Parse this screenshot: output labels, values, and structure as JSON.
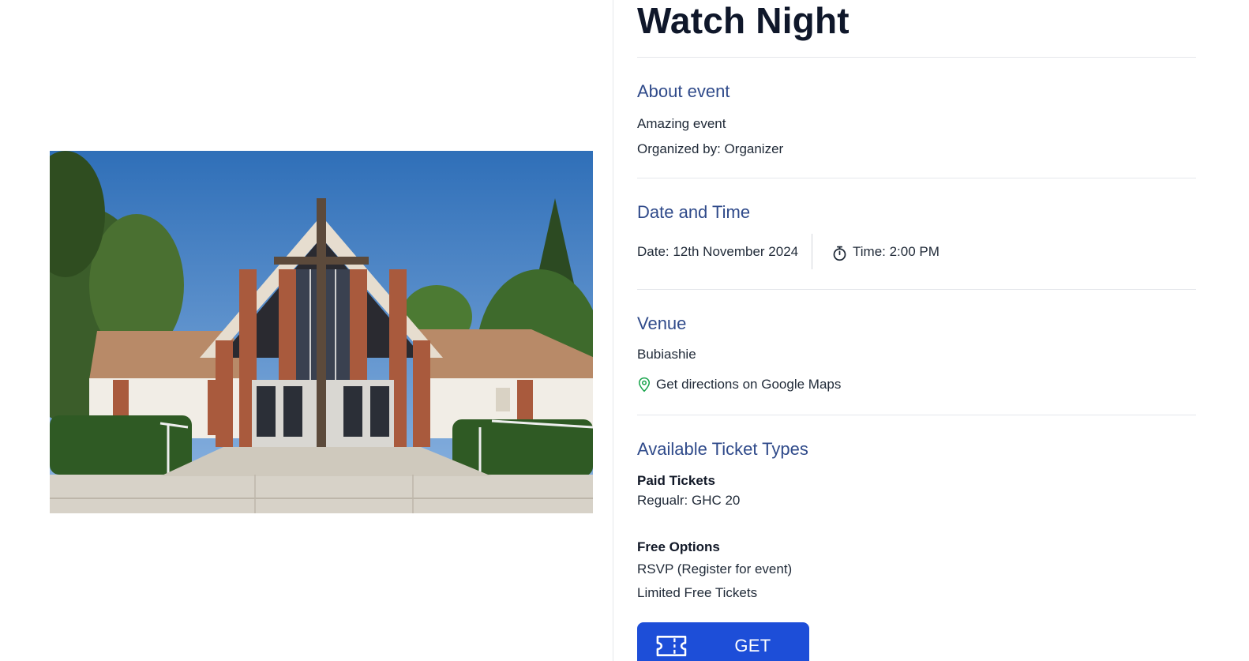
{
  "event": {
    "title": "Watch Night",
    "image_alt": "Church building with a large cross"
  },
  "about": {
    "heading": "About event",
    "description": "Amazing event",
    "organizer": "Organized by: Organizer"
  },
  "datetime": {
    "heading": "Date and Time",
    "date": "Date: 12th November 2024",
    "time": "Time: 2:00 PM",
    "time_icon": "stopwatch-icon"
  },
  "venue": {
    "heading": "Venue",
    "name": "Bubiashie",
    "directions_label": "Get directions on Google Maps",
    "directions_icon": "map-pin-icon"
  },
  "tickets": {
    "heading": "Available Ticket Types",
    "paid_heading": "Paid Tickets",
    "paid_items": [
      "Regualr: GHC 20"
    ],
    "free_heading": "Free Options",
    "free_items": [
      "RSVP (Register for event)",
      "Limited Free Tickets"
    ],
    "button_label": "GET TICKETS",
    "button_icon": "ticket-icon"
  },
  "colors": {
    "heading": "#2f4a8a",
    "button": "#1d4ed8",
    "map_pin": "#16a34a"
  }
}
